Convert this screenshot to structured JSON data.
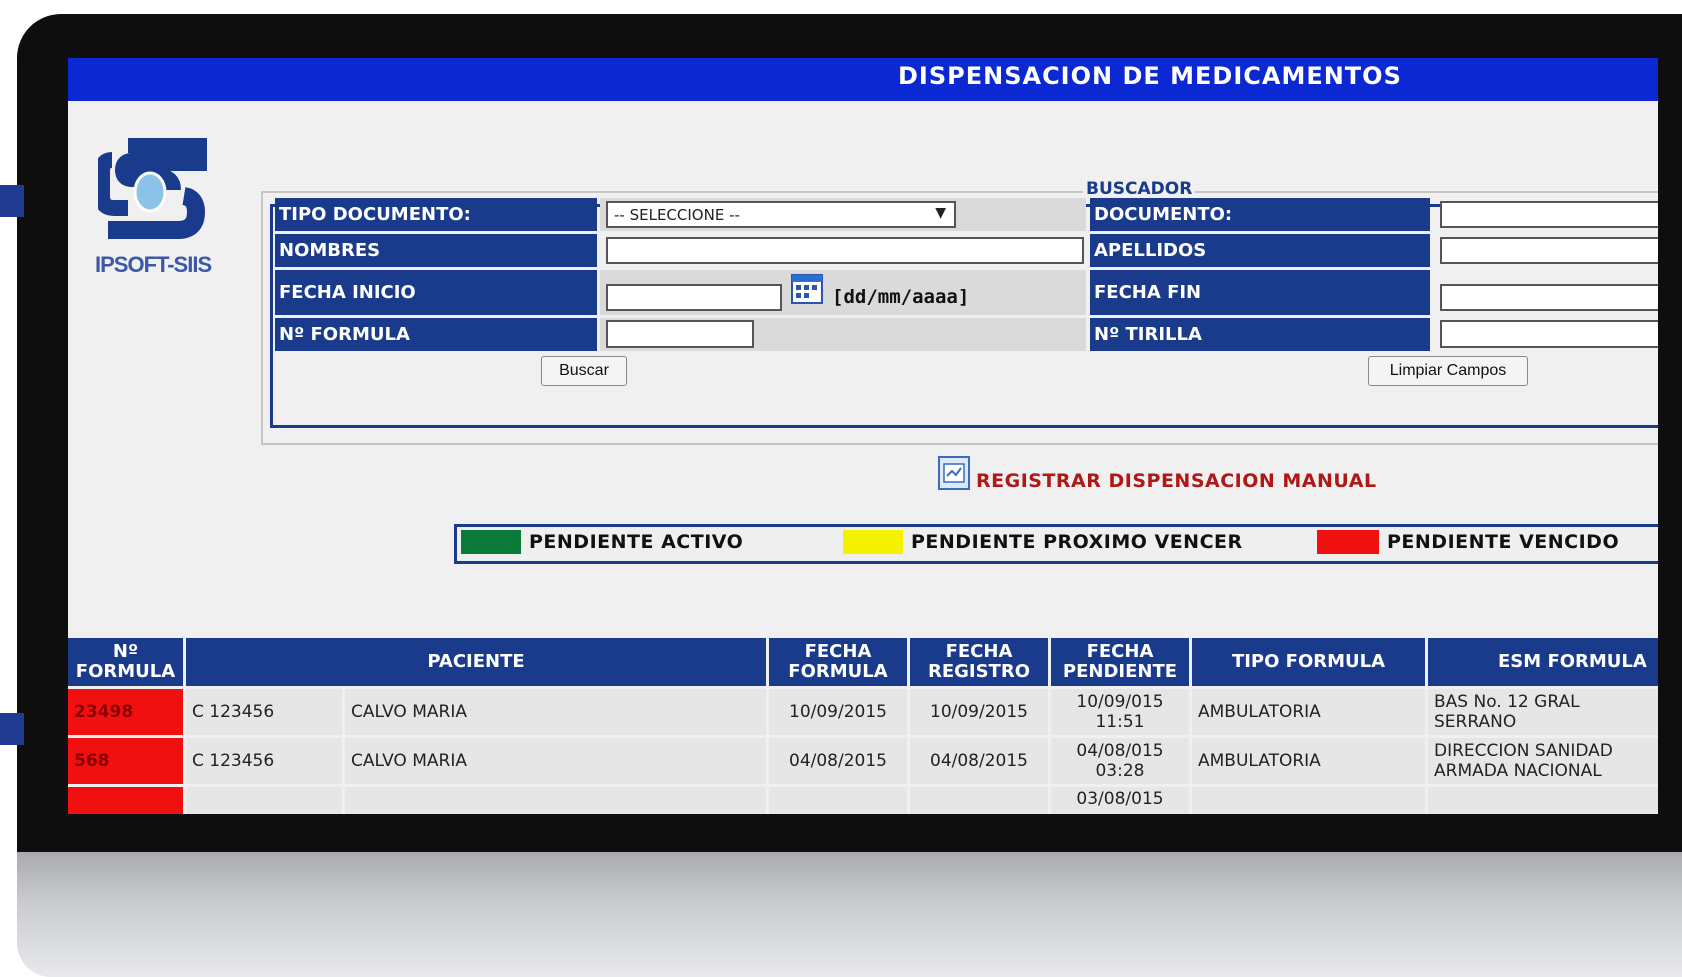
{
  "window": {
    "title": "DISPENSACION DE MEDICAMENTOS"
  },
  "logo": {
    "text": "IPSOFT-SIIS"
  },
  "buscador": {
    "legend": "BUSCADOR",
    "tipo_documento_label": "TIPO DOCUMENTO:",
    "tipo_documento_value": "-- SELECCIONE --",
    "documento_label": "DOCUMENTO:",
    "nombres_label": "NOMBRES",
    "apellidos_label": "APELLIDOS",
    "fecha_inicio_label": "FECHA INICIO",
    "date_format_hint": "[dd/mm/aaaa]",
    "fecha_fin_label": "FECHA FIN",
    "formula_label": "Nº FORMULA",
    "tirilla_label": "Nº TIRILLA",
    "buscar_button": "Buscar",
    "limpiar_button": "Limpiar Campos"
  },
  "registrar_link": "REGISTRAR DISPENSACION MANUAL",
  "status_legend": [
    {
      "label": "PENDIENTE ACTIVO",
      "color": "#0a7a3a"
    },
    {
      "label": "PENDIENTE PROXIMO VENCER",
      "color": "#f5f200"
    },
    {
      "label": "PENDIENTE VENCIDO",
      "color": "#f01010"
    }
  ],
  "table": {
    "headers": [
      "Nº\nFORMULA",
      "PACIENTE",
      "FECHA\nFORMULA",
      "FECHA\nREGISTRO",
      "FECHA\nPENDIENTE",
      "TIPO FORMULA",
      "ESM FORMULA"
    ],
    "rows": [
      {
        "formula": "23498",
        "doc": "C 123456",
        "nombre": "CALVO MARIA",
        "fecha_formula": "10/09/2015",
        "fecha_registro": "10/09/2015",
        "fecha_pendiente": "10/09/015\n11:51",
        "tipo": "AMBULATORIA",
        "esm": "BAS No. 12 GRAL\nSERRANO"
      },
      {
        "formula": "568",
        "doc": "C 123456",
        "nombre": "CALVO MARIA",
        "fecha_formula": "04/08/2015",
        "fecha_registro": "04/08/2015",
        "fecha_pendiente": "04/08/015\n03:28",
        "tipo": "AMBULATORIA",
        "esm": "DIRECCION SANIDAD\nARMADA NACIONAL"
      },
      {
        "formula": "",
        "doc": "",
        "nombre": "",
        "fecha_formula": "",
        "fecha_registro": "",
        "fecha_pendiente": "03/08/015",
        "tipo": "",
        "esm": ""
      }
    ]
  },
  "colors": {
    "title_bar": "#0c28d3",
    "header_blue": "#1a3a8c",
    "overdue_red": "#f01010"
  }
}
